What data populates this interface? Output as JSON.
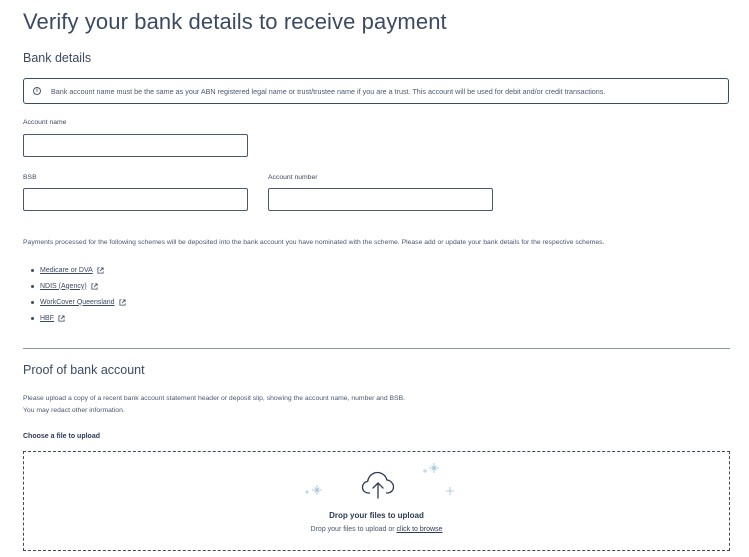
{
  "page": {
    "title": "Verify your bank details to receive payment"
  },
  "bank_details": {
    "heading": "Bank details",
    "info": "Bank account name must be the same as your ABN registered legal name or trust/trustee name if you are a trust. This account will be used for debit and/or credit transactions.",
    "info_icon": "i",
    "account_name_label": "Account name",
    "account_name_value": "",
    "bsb_label": "BSB",
    "bsb_value": "",
    "account_number_label": "Account number",
    "account_number_value": ""
  },
  "schemes": {
    "intro": "Payments processed for the following schemes will be deposited into the bank account you have nominated with the scheme. Please add or update your bank details for the respective schemes.",
    "items": [
      {
        "label": "Medicare or DVA",
        "icon": "external-link-icon"
      },
      {
        "label": "NDIS (Agency)",
        "icon": "external-link-icon"
      },
      {
        "label": "WorkCover Queensland",
        "icon": "external-link-icon"
      },
      {
        "label": "HBF",
        "icon": "external-link-icon"
      }
    ]
  },
  "proof": {
    "heading": "Proof of bank account",
    "line1": "Please upload a copy of a recent bank account statement header or deposit slip, showing the account name, number and BSB.",
    "line2": "You may redact other information.",
    "upload_label": "Choose a file to upload",
    "drop_title": "Drop your files to upload",
    "drop_sub_prefix": "Drop your files to upload or",
    "browse_link": "click to browse",
    "upload_icon": "cloud-upload-icon"
  },
  "colors": {
    "text": "#2b3a55",
    "border": "#3b4a63",
    "sparkle": "#9fc1d6"
  }
}
